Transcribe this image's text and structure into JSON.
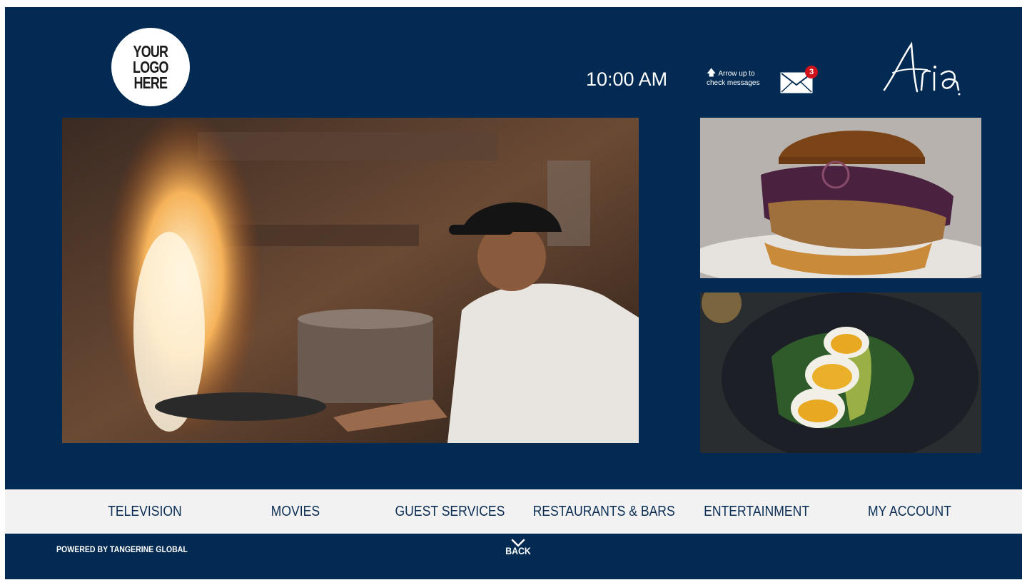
{
  "header": {
    "logo_text": "YOUR\nLOGO\nHERE",
    "time": "10:00 AM",
    "message_hint_line1": "Arrow up to",
    "message_hint_line2": "check messages",
    "message_count": "3",
    "brand_name": "Aria"
  },
  "images": [
    {
      "name": "chef-flambe-photo",
      "icon": "photo-chef-cooking"
    },
    {
      "name": "burger-photo",
      "icon": "photo-burger"
    },
    {
      "name": "egg-salad-photo",
      "icon": "photo-egg-avocado-salad"
    }
  ],
  "nav": {
    "items": [
      {
        "label": "TELEVISION"
      },
      {
        "label": "MOVIES"
      },
      {
        "label": "GUEST SERVICES"
      },
      {
        "label": "RESTAURANTS & BARS"
      },
      {
        "label": "ENTERTAINMENT"
      },
      {
        "label": "MY ACCOUNT"
      }
    ]
  },
  "footer": {
    "powered_by": "POWERED BY TANGERINE GLOBAL",
    "back_label": "BACK"
  },
  "colors": {
    "background": "#032a52",
    "nav_background": "#f2f2f2",
    "nav_text": "#0b2e55",
    "badge": "#d0121b"
  }
}
